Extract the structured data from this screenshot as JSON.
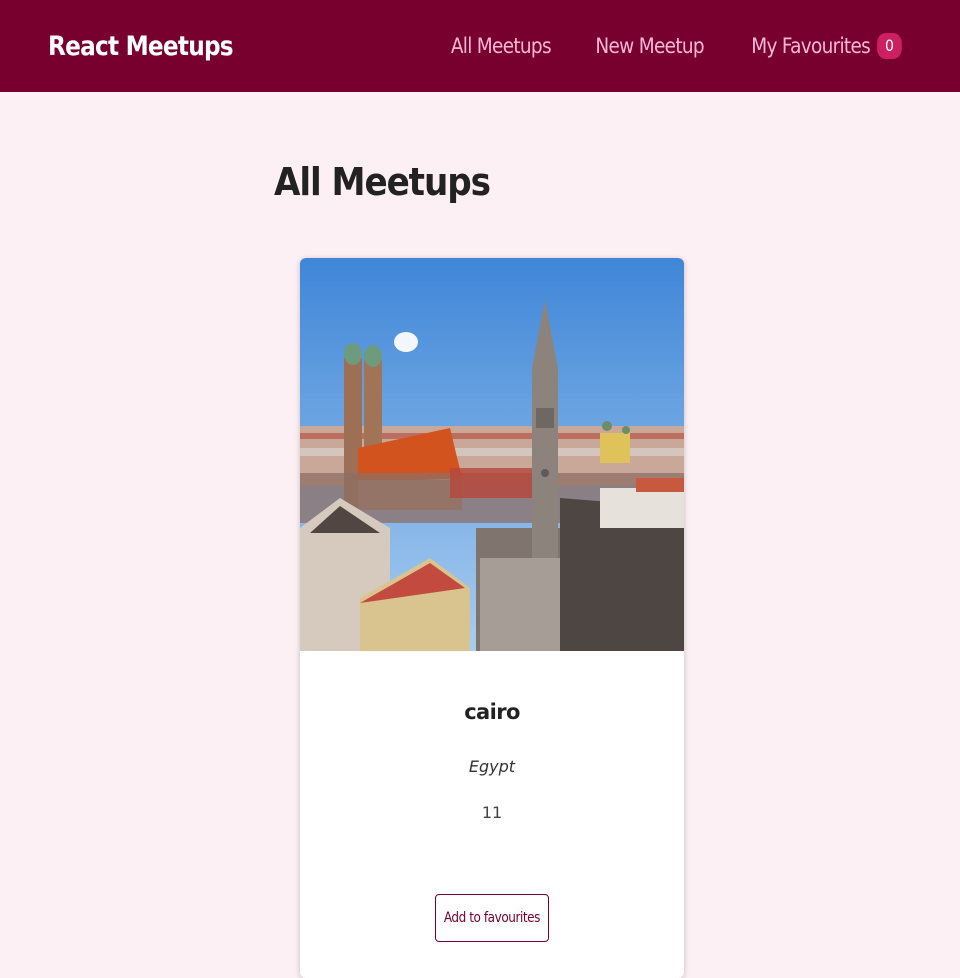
{
  "header": {
    "logo": "React Meetups",
    "nav": {
      "all_meetups": "All Meetups",
      "new_meetup": "New Meetup",
      "my_favourites": "My Favourites",
      "favourites_count": "0"
    }
  },
  "main": {
    "title": "All Meetups",
    "meetups": [
      {
        "image_alt": "cairo",
        "title": "cairo",
        "address": "Egypt",
        "description": "11",
        "action_label": "Add to favourites"
      }
    ]
  },
  "colors": {
    "header_bg": "#77002e",
    "page_bg": "#fcf0f4",
    "nav_text": "#fcb8d2",
    "badge_bg": "#cc2062",
    "accent": "#77002e"
  },
  "icons": {
    "meetup_image": "city-skyline-photo"
  }
}
